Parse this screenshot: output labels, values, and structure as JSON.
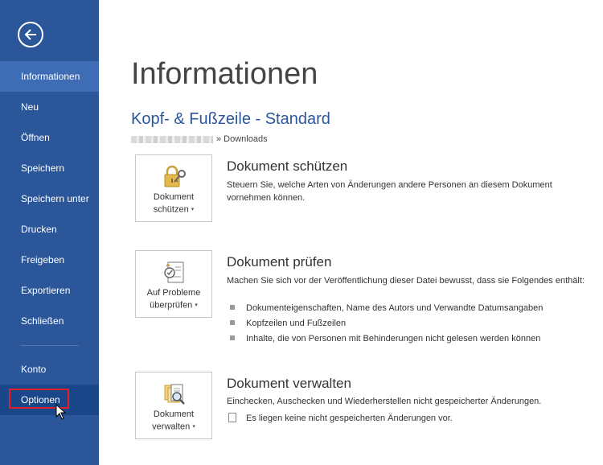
{
  "sidebar": {
    "back_icon": "back-arrow-icon",
    "items": [
      {
        "label": "Informationen"
      },
      {
        "label": "Neu"
      },
      {
        "label": "Öffnen"
      },
      {
        "label": "Speichern"
      },
      {
        "label": "Speichern unter"
      },
      {
        "label": "Drucken"
      },
      {
        "label": "Freigeben"
      },
      {
        "label": "Exportieren"
      },
      {
        "label": "Schließen"
      },
      {
        "label": "Konto"
      },
      {
        "label": "Optionen"
      }
    ],
    "accent": "#2b579a",
    "highlight": "#e0202a"
  },
  "main": {
    "page_title": "Informationen",
    "document_title": "Kopf- & Fußzeile - Standard",
    "path_suffix": "» Downloads",
    "sections": [
      {
        "button_line1": "Dokument",
        "button_line2": "schützen",
        "button_icon": "lock-key-icon",
        "title": "Dokument schützen",
        "description": "Steuern Sie, welche Arten von Änderungen andere Personen an diesem Dokument vornehmen können."
      },
      {
        "button_line1": "Auf Probleme",
        "button_line2": "überprüfen",
        "button_icon": "inspect-document-icon",
        "title": "Dokument prüfen",
        "description": "Machen Sie sich vor der Veröffentlichung dieser Datei bewusst, dass sie Folgendes enthält:",
        "bullets": [
          "Dokumenteigenschaften, Name des Autors und Verwandte Datumsangaben",
          "Kopfzeilen und Fußzeilen",
          "Inhalte, die von Personen mit Behinderungen nicht gelesen werden können"
        ]
      },
      {
        "button_line1": "Dokument",
        "button_line2": "verwalten",
        "button_icon": "manage-document-icon",
        "title": "Dokument verwalten",
        "description": "Einchecken, Auschecken und Wiederherstellen nicht gespeicherter Änderungen.",
        "note": "Es liegen keine nicht gespeicherten Änderungen vor."
      }
    ]
  }
}
